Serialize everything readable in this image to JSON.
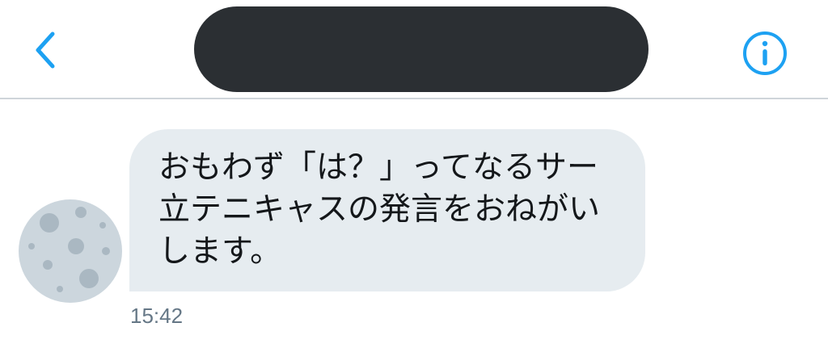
{
  "header": {
    "back_icon": "chevron-left-icon",
    "info_icon": "info-circle-icon",
    "accent_color": "#1da1f2",
    "title_redaction_color": "#2b2f33"
  },
  "message": {
    "lines": [
      "おもわず「は？」ってなるサー",
      "立テニキャスの発言をおねがい",
      "します。"
    ],
    "timestamp": "15:42",
    "bubble_color": "#e6ecf0"
  },
  "avatar": {
    "icon": "moon-avatar-icon"
  }
}
